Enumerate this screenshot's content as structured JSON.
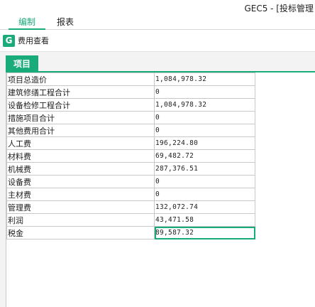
{
  "window": {
    "title": "GEC5 - [投标管理"
  },
  "menu_tabs": [
    {
      "label": "编制",
      "active": true
    },
    {
      "label": "报表",
      "active": false
    }
  ],
  "toolbar": {
    "view_fees_label": "费用查看",
    "icon_letter": "G"
  },
  "panel": {
    "tab_label": "项目"
  },
  "fee_table": {
    "rows": [
      {
        "name": "项目总造价",
        "value": "1,084,978.32"
      },
      {
        "name": "建筑修缮工程合计",
        "value": "0"
      },
      {
        "name": "设备检修工程合计",
        "value": "1,084,978.32"
      },
      {
        "name": "措施项目合计",
        "value": "0"
      },
      {
        "name": "其他费用合计",
        "value": "0"
      },
      {
        "name": "人工费",
        "value": "196,224.80"
      },
      {
        "name": "材料费",
        "value": "69,482.72"
      },
      {
        "name": "机械费",
        "value": "287,376.51"
      },
      {
        "name": "设备费",
        "value": "0"
      },
      {
        "name": "主材费",
        "value": "0"
      },
      {
        "name": "管理费",
        "value": "132,072.74"
      },
      {
        "name": "利润",
        "value": "43,471.58"
      },
      {
        "name": "税金",
        "value": "89,587.32",
        "selected": true
      }
    ]
  },
  "colors": {
    "accent": "#1aab7b",
    "grid_line": "#c8c8c8",
    "panel_bg": "#f3f3f3"
  }
}
